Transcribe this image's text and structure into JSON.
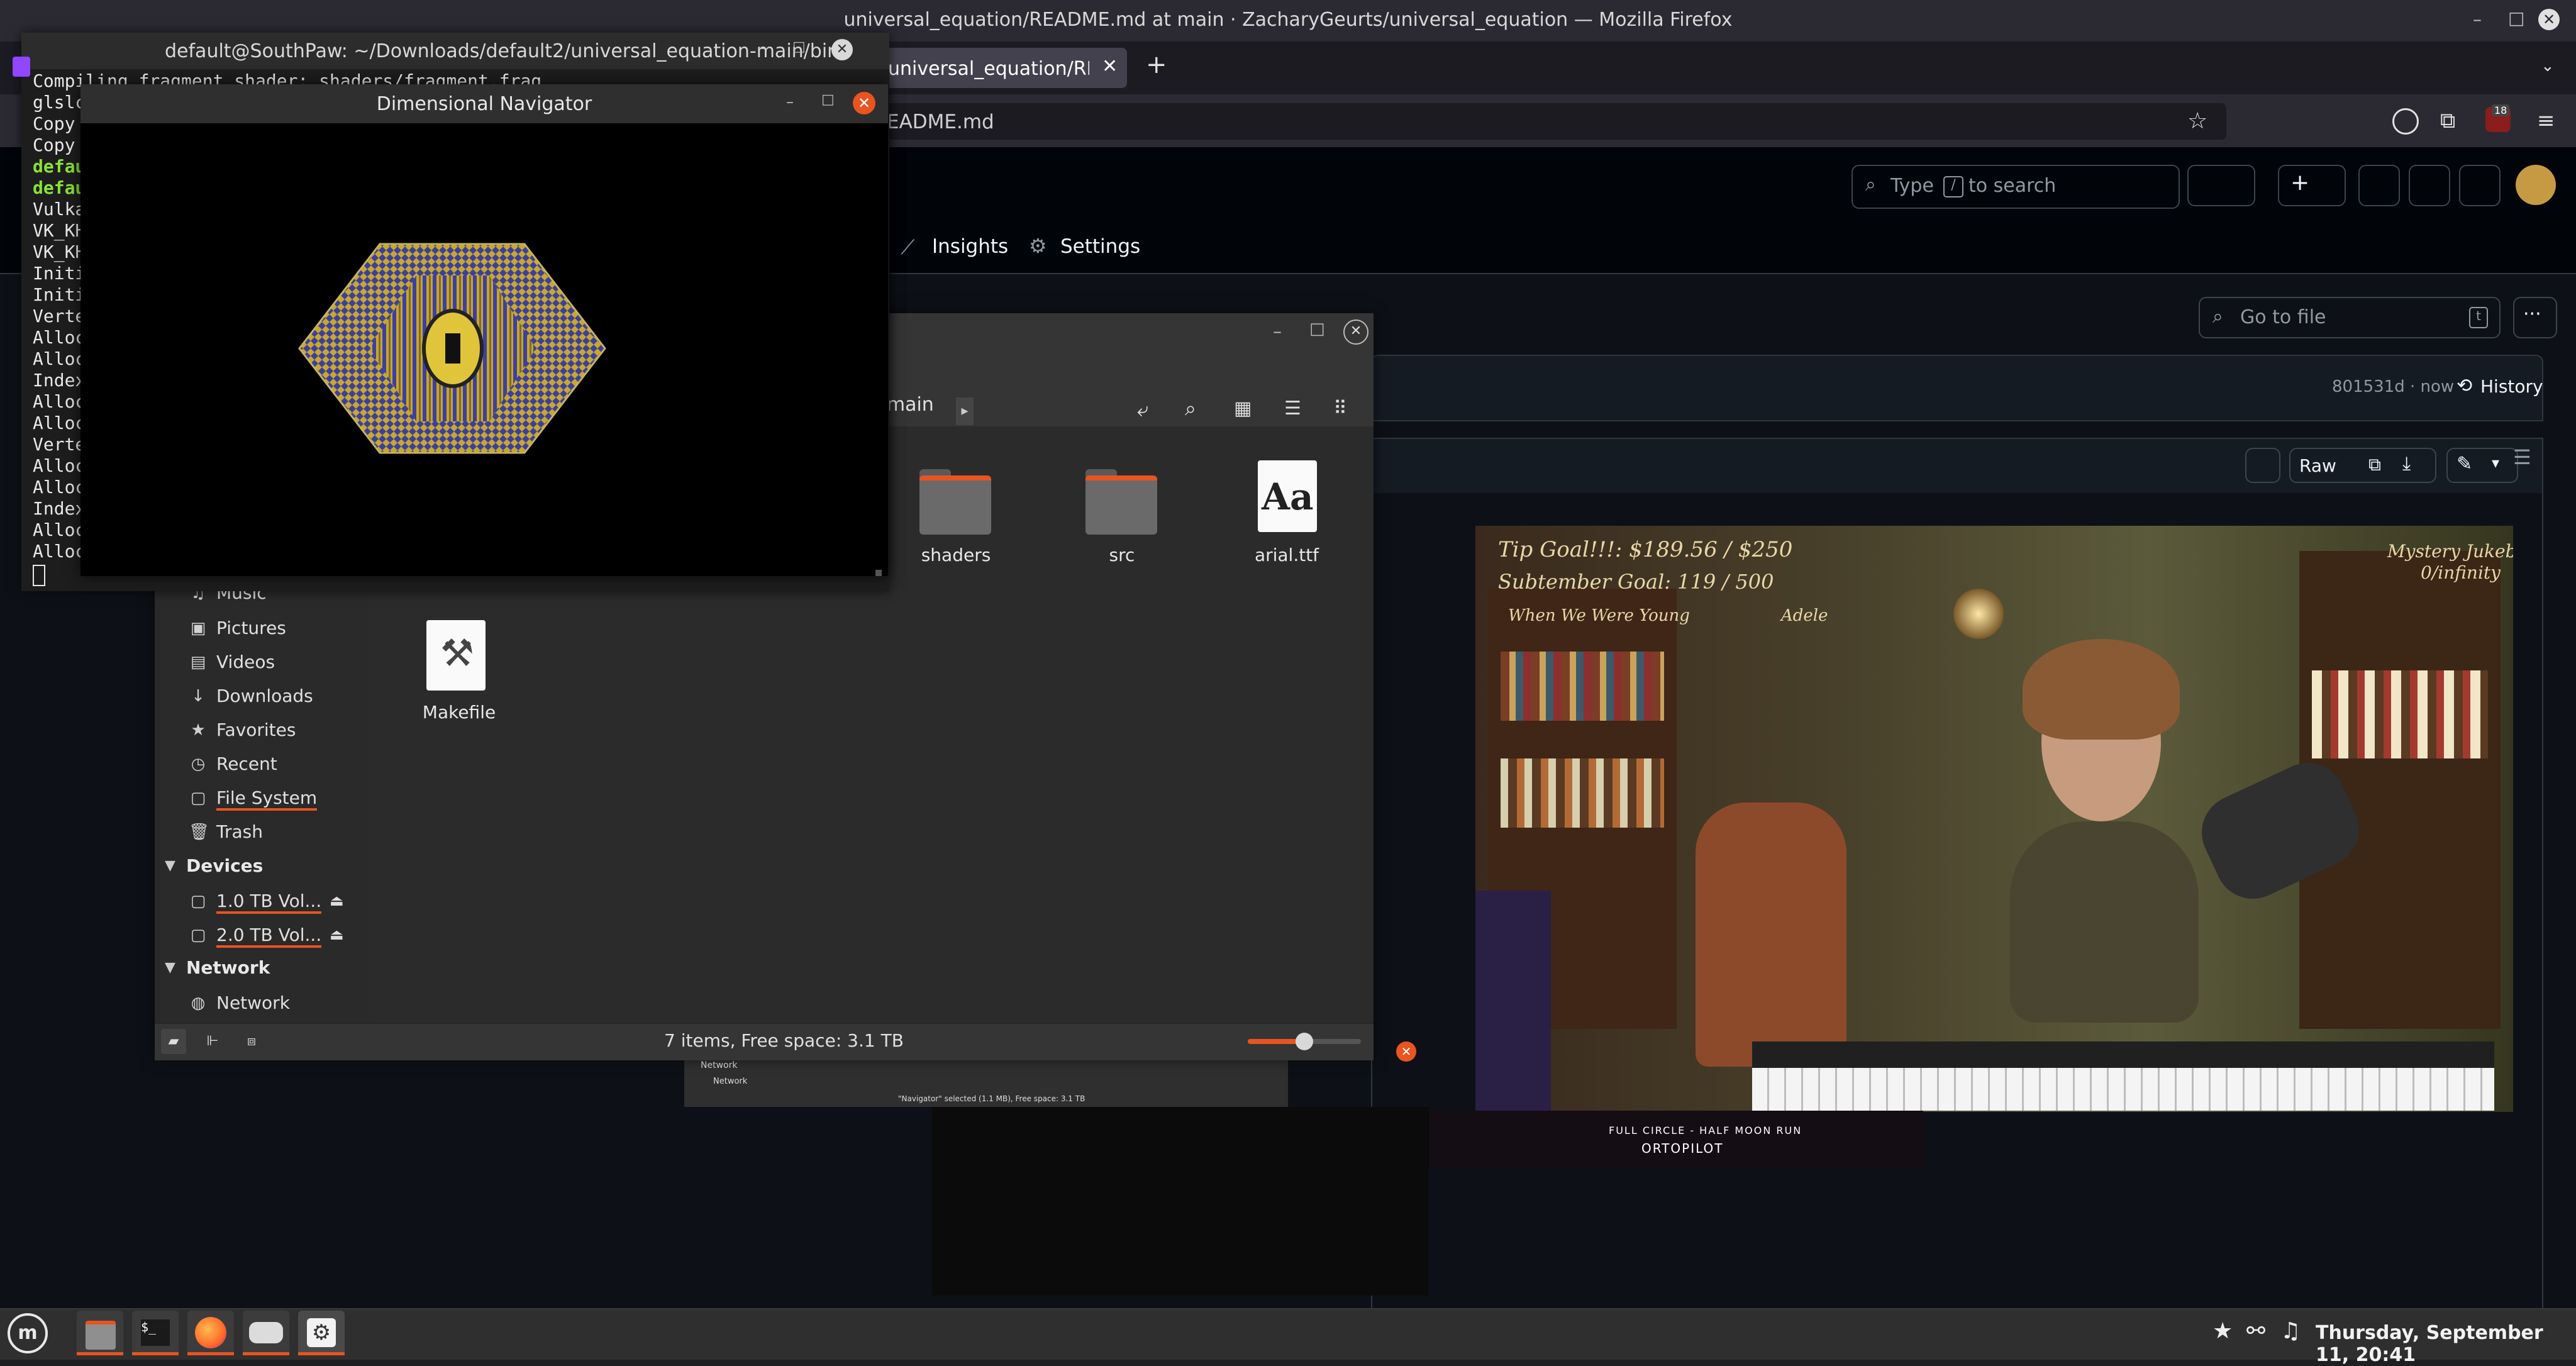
{
  "firefox": {
    "window_title": "universal_equation/README.md at main · ZacharyGeurts/universal_equation — Mozilla Firefox",
    "tab_title": "universal_equation/README.",
    "url_tail": "EADME.md",
    "badge_count": "18"
  },
  "github": {
    "search_prefix": "Type",
    "search_key": "/",
    "search_suffix": "to search",
    "nav_insights": "Insights",
    "nav_settings": "Settings",
    "goto_placeholder": "Go to file",
    "goto_key": "t",
    "commit": "801531d · now",
    "history": "History",
    "raw": "Raw"
  },
  "stream": {
    "tip_goal": "Tip Goal!!!: $189.56 / $250",
    "sub_goal": "Subtember Goal: 119 / 500",
    "song": "When We Were Young",
    "artist": "Adele",
    "jukebox": "Mystery Jukebox",
    "jukebox_count": "0/infinity",
    "obs_caption1": "FULL CIRCLE - HALF MOON RUN",
    "obs_caption2": "ORTOPILOT"
  },
  "terminal": {
    "title": "default@SouthPaw: ~/Downloads/default2/universal_equation-main/bin",
    "lines": [
      {
        "text": "Compiling fragment shader: shaders/fragment.frag",
        "green": false
      },
      {
        "text": "glslc",
        "green": false
      },
      {
        "text": "Copy",
        "green": false
      },
      {
        "text": "Copy",
        "green": false
      },
      {
        "text": "defau",
        "green": true
      },
      {
        "text": "defau",
        "green": true
      },
      {
        "text": "Vulka",
        "green": false
      },
      {
        "text": "VK_KH",
        "green": false
      },
      {
        "text": "VK_KH",
        "green": false
      },
      {
        "text": "Initi",
        "green": false
      },
      {
        "text": "Initi",
        "green": false
      },
      {
        "text": "Verte",
        "green": false
      },
      {
        "text": "Alloc",
        "green": false
      },
      {
        "text": "Alloc",
        "green": false
      },
      {
        "text": "Index",
        "green": false
      },
      {
        "text": "Alloc",
        "green": false
      },
      {
        "text": "Alloc",
        "green": false
      },
      {
        "text": "Verte",
        "green": false
      },
      {
        "text": "Alloc",
        "green": false
      },
      {
        "text": "Alloc",
        "green": false
      },
      {
        "text": "Index",
        "green": false
      },
      {
        "text": "Alloc",
        "green": false
      },
      {
        "text": "Alloc",
        "green": false
      }
    ]
  },
  "navigator": {
    "title": "Dimensional Navigator"
  },
  "files": {
    "path_tail": "n-main",
    "items": [
      {
        "label": "shaders",
        "kind": "folder"
      },
      {
        "label": "src",
        "kind": "folder"
      },
      {
        "label": "arial.ttf",
        "kind": "font"
      },
      {
        "label": "Makefile",
        "kind": "makefile"
      }
    ],
    "font_glyph": "Aa",
    "sidebar": {
      "places": [
        "Music",
        "Pictures",
        "Videos",
        "Downloads",
        "Favorites",
        "Recent",
        "File System",
        "Trash"
      ],
      "devices_header": "Devices",
      "devices": [
        "1.0 TB Vol...",
        "2.0 TB Vol..."
      ],
      "network_header": "Network",
      "network": [
        "Network"
      ]
    },
    "status": "7 items, Free space: 3.1 TB",
    "zoom": 0.5
  },
  "ghost": {
    "network": "Network",
    "network_item": "Network",
    "status": "\"Navigator\" selected (1.1 MB), Free space: 3.1 TB"
  },
  "taskbar": {
    "clock": "Thursday, September 11, 20:41"
  }
}
